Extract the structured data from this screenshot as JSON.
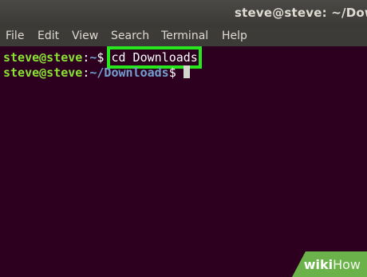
{
  "window": {
    "title": "steve@steve: ~/Down"
  },
  "menu": {
    "items": [
      "File",
      "Edit",
      "View",
      "Search",
      "Terminal",
      "Help"
    ]
  },
  "terminal": {
    "lines": [
      {
        "user": "steve@steve",
        "colon": ":",
        "path": "~",
        "symbol": "$ ",
        "command": "cd Downloads"
      },
      {
        "user": "steve@steve",
        "colon": ":",
        "path": "~/Downloads",
        "symbol": "$ ",
        "command": ""
      }
    ]
  },
  "watermark": {
    "part1": "wiki",
    "part2": "How"
  },
  "colors": {
    "background": "#2c001e",
    "prompt_user": "#8ae234",
    "prompt_path": "#729fcf",
    "highlight": "#27e61d",
    "watermark": "#6bb24a"
  }
}
